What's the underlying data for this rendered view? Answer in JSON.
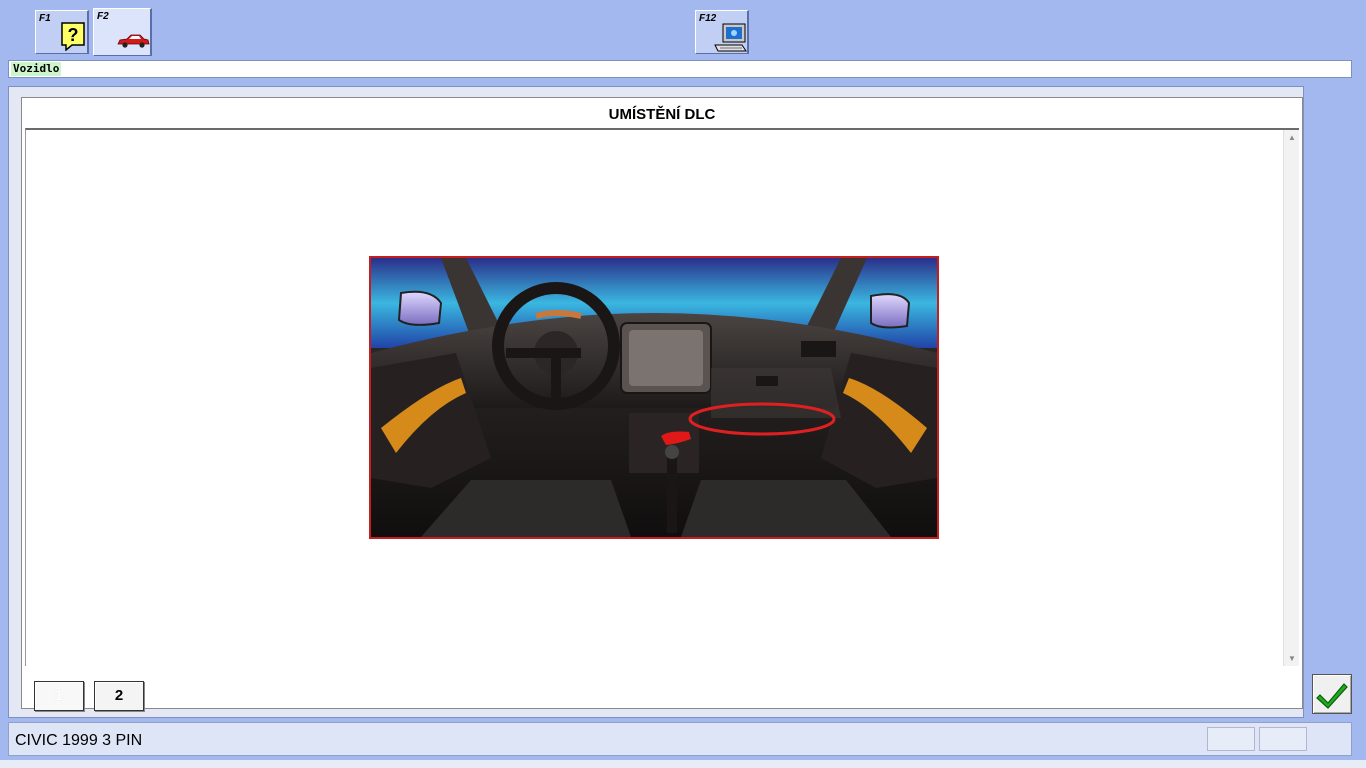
{
  "toolbar": {
    "f1": {
      "key": "F1",
      "icon": "help-question-icon"
    },
    "f2": {
      "key": "F2",
      "icon": "red-car-icon"
    },
    "f12": {
      "key": "F12",
      "icon": "computer-terminal-icon"
    }
  },
  "vehicle_bar": {
    "label": "Vozidlo"
  },
  "panel": {
    "title": "UMÍSTĚNÍ DLC",
    "image_alt": "dashboard-interior-dlc-location"
  },
  "pagination": {
    "pages": [
      "1",
      "2"
    ],
    "current": "1"
  },
  "status": {
    "vehicle": "CIVIC 1999 3 PIN"
  },
  "colors": {
    "background": "#a4b8f0",
    "highlight_ring": "#e02020",
    "ok_check": "#1faa1f"
  }
}
